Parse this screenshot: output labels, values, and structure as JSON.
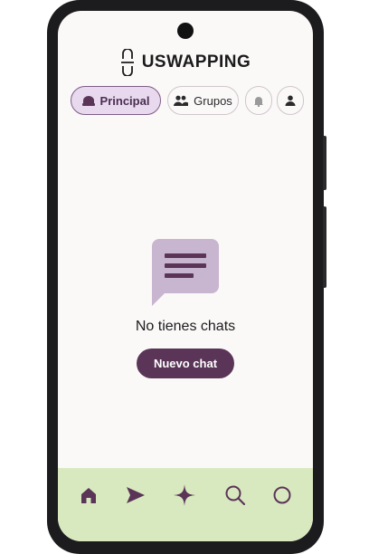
{
  "brand": {
    "name": "USWAPPING"
  },
  "tabs": [
    {
      "label": "Principal",
      "icon": "inbox-icon",
      "active": true
    },
    {
      "label": "Grupos",
      "icon": "group-icon",
      "active": false
    },
    {
      "label": "",
      "icon": "bell-icon",
      "active": false
    },
    {
      "label": "",
      "icon": "person-icon",
      "active": false
    }
  ],
  "empty_state": {
    "icon": "chat-bubble-icon",
    "message": "No tienes chats",
    "button_label": "Nuevo chat"
  },
  "bottom_nav": [
    {
      "icon": "home-icon",
      "active": true
    },
    {
      "icon": "send-icon"
    },
    {
      "icon": "sparkle-icon"
    },
    {
      "icon": "search-icon"
    },
    {
      "icon": "circle-icon"
    }
  ],
  "colors": {
    "accent": "#5a3558",
    "active_tab_bg": "#e8d9ee",
    "navbar_bg": "#d9e9bf",
    "chat_icon": "#c8b5cf"
  }
}
